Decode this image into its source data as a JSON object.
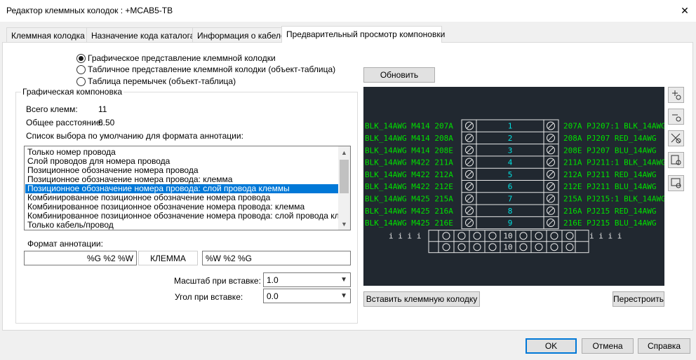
{
  "window": {
    "title": "Редактор клеммных колодок : +MCAB5-TB",
    "close_glyph": "✕"
  },
  "tabs": [
    {
      "label": "Клеммная колодка"
    },
    {
      "label": "Назначение кода каталога"
    },
    {
      "label": "Информация о кабеле"
    },
    {
      "label": "Предварительный просмотр компоновки",
      "active": true
    }
  ],
  "radios": [
    {
      "label": "Графическое представление клеммной колодки",
      "checked": true
    },
    {
      "label": "Табличное представление клеммной колодки (объект-таблица)",
      "checked": false
    },
    {
      "label": "Таблица перемычек (объект-таблица)",
      "checked": false
    }
  ],
  "layout_group": {
    "title": "Графическая компоновка",
    "total_label": "Всего клемм:",
    "total_value": "11",
    "distance_label": "Общее расстояние:",
    "distance_value": "6.50",
    "list_label": "Список выбора по умолчанию для формата аннотации:",
    "list_items": [
      "Только номер провода",
      "Слой проводов для номера провода",
      "Позиционное обозначение номера провода",
      "Позиционное обозначение номера провода: клемма",
      "Позиционное обозначение номера провода: слой провода клеммы",
      "Комбинированное позиционное обозначение номера провода",
      "Комбинированное позиционное обозначение номера провода: клемма",
      "Комбинированное позиционное обозначение номера провода: слой провода клеммы",
      "Только кабель/провод"
    ],
    "selected_index": 4,
    "format_label": "Формат аннотации:",
    "format_left": "%G %2 %W",
    "format_middle": "КЛЕММА",
    "format_right": "%W %2 %G",
    "scale_label": "Масштаб при вставке:",
    "scale_value": "1.0",
    "angle_label": "Угол при вставке:",
    "angle_value": "0.0"
  },
  "buttons": {
    "refresh": "Обновить",
    "insert": "Вставить клеммную колодку",
    "rebuild": "Перестроить",
    "ok": "OK",
    "cancel": "Отмена",
    "help": "Справка"
  },
  "preview": {
    "background": "#212830",
    "wire_color": "#00e000",
    "number_color": "#00e0e0",
    "rows": [
      {
        "left": "BLK_14AWG  M414  207A",
        "num": "1",
        "right": "207A  PJ207:1  BLK_14AWG"
      },
      {
        "left": "BLK_14AWG  M414  208A",
        "num": "2",
        "right": "208A  PJ207  RED_14AWG"
      },
      {
        "left": "BLK_14AWG  M414  208E",
        "num": "3",
        "right": "208E  PJ207  BLU_14AWG"
      },
      {
        "left": "BLK_14AWG  M422  211A",
        "num": "4",
        "right": "211A  PJ211:1  BLK_14AWG"
      },
      {
        "left": "BLK_14AWG  M422  212A",
        "num": "5",
        "right": "212A  PJ211  RED_14AWG"
      },
      {
        "left": "BLK_14AWG  M422  212E",
        "num": "6",
        "right": "212E  PJ211  BLU_14AWG"
      },
      {
        "left": "BLK_14AWG  M425  215A",
        "num": "7",
        "right": "215A  PJ215:1  BLK_14AWG"
      },
      {
        "left": "BLK_14AWG  M425  216A",
        "num": "8",
        "right": "216A  PJ215  RED_14AWG"
      },
      {
        "left": "BLK_14AWG  M425  216E",
        "num": "9",
        "right": "216E  PJ215  BLU_14AWG"
      }
    ],
    "bottom_nums": [
      "10",
      "10"
    ],
    "tick_marks": "i  i  i  i"
  },
  "tools": [
    "zoom-in-icon",
    "zoom-out-icon",
    "zoom-extents-icon",
    "zoom-window-icon",
    "zoom-previous-icon"
  ]
}
